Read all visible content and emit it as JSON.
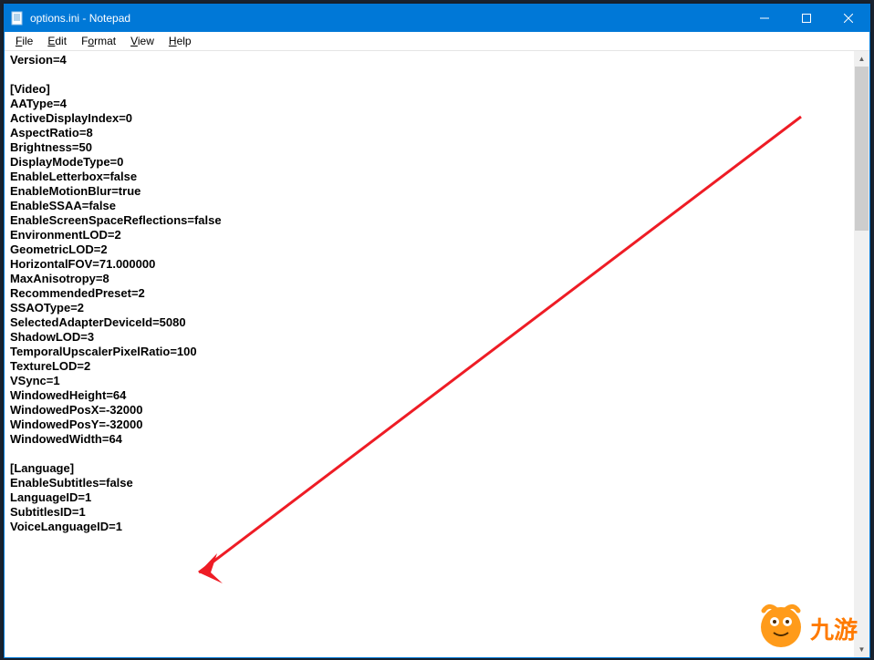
{
  "window": {
    "title": "options.ini - Notepad"
  },
  "menu": {
    "file": "File",
    "edit": "Edit",
    "format": "Format",
    "view": "View",
    "help": "Help"
  },
  "editor": {
    "lines": [
      "Version=4",
      "",
      "[Video]",
      "AAType=4",
      "ActiveDisplayIndex=0",
      "AspectRatio=8",
      "Brightness=50",
      "DisplayModeType=0",
      "EnableLetterbox=false",
      "EnableMotionBlur=true",
      "EnableSSAA=false",
      "EnableScreenSpaceReflections=false",
      "EnvironmentLOD=2",
      "GeometricLOD=2",
      "HorizontalFOV=71.000000",
      "MaxAnisotropy=8",
      "RecommendedPreset=2",
      "SSAOType=2",
      "SelectedAdapterDeviceId=5080",
      "ShadowLOD=3",
      "TemporalUpscalerPixelRatio=100",
      "TextureLOD=2",
      "VSync=1",
      "WindowedHeight=64",
      "WindowedPosX=-32000",
      "WindowedPosY=-32000",
      "WindowedWidth=64",
      "",
      "[Language]",
      "EnableSubtitles=false",
      "LanguageID=1",
      "SubtitlesID=1",
      "VoiceLanguageID=1"
    ]
  },
  "watermark": {
    "text": "九游"
  }
}
